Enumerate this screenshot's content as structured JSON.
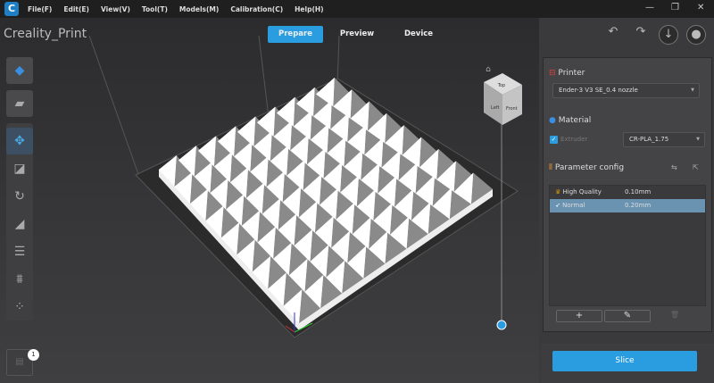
{
  "menubar": {
    "items": [
      "File(F)",
      "Edit(E)",
      "View(V)",
      "Tool(T)",
      "Models(M)",
      "Calibration(C)",
      "Help(H)"
    ]
  },
  "app_title": "Creality_Print",
  "tabs": [
    {
      "label": "Prepare",
      "active": true
    },
    {
      "label": "Preview"
    },
    {
      "label": "Device"
    }
  ],
  "view_cube": {
    "top": "Top",
    "left": "Left",
    "front": "Front"
  },
  "model": {
    "rows": 9,
    "cols": 9
  },
  "files_badge": "1",
  "panel": {
    "printer": {
      "title": "Printer",
      "value": "Ender-3 V3 SE_0.4 nozzle"
    },
    "material": {
      "title": "Material",
      "extruder_label": "Extruder",
      "extruder_checked": true,
      "value": "CR-PLA_1.75"
    },
    "params": {
      "title": "Parameter config",
      "rows": [
        {
          "name": "High Quality",
          "value": "0.10mm"
        },
        {
          "name": "Normal",
          "value": "0.20mm",
          "selected": true
        }
      ]
    },
    "add": "+",
    "edit": "✎",
    "delete": "🗑"
  },
  "slice_label": "Slice",
  "colors": {
    "accent": "#2a9de0",
    "selected_row": "#6a93b2"
  }
}
